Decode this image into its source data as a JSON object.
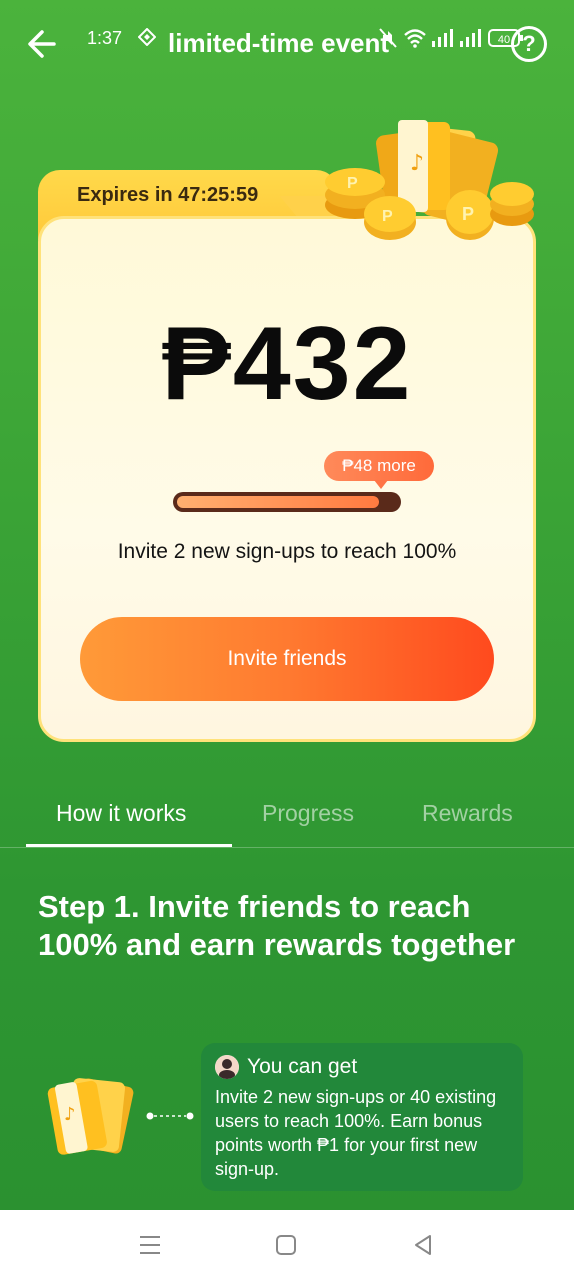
{
  "status": {
    "time": "1:37",
    "battery": "40"
  },
  "header": {
    "title": "limited-time event",
    "help_label": "?"
  },
  "card": {
    "expires": "Expires in 47:25:59",
    "amount": "₱432",
    "more_badge": "₱48 more",
    "progress_percent": 92,
    "invite_text": "Invite 2 new sign-ups to reach 100%",
    "invite_button": "Invite friends"
  },
  "tabs": [
    {
      "label": "How it works"
    },
    {
      "label": "Progress"
    },
    {
      "label": "Rewards"
    }
  ],
  "step": {
    "title": "Step 1. Invite friends to reach 100% and earn rewards together",
    "info_head": "You can get",
    "info_body": "Invite 2 new sign-ups or 40 existing users to reach 100%. Earn bonus points worth ₱1 for your first new sign-up."
  },
  "colors": {
    "accent": "#ff7a30",
    "background": "#3aa336",
    "card": "#fff9d8"
  }
}
